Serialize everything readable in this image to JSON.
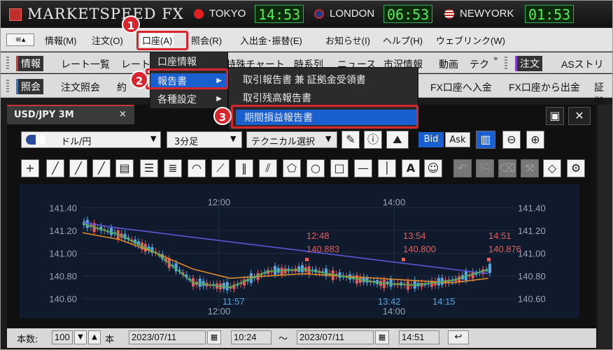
{
  "app": {
    "title": "MARKETSPEED FX"
  },
  "markets": [
    {
      "name": "TOKYO",
      "time": "14:53",
      "dot_color": "#e02020"
    },
    {
      "name": "LONDON",
      "time": "06:53",
      "dot_color": "#c62828"
    },
    {
      "name": "NEWYORK",
      "time": "01:53",
      "dot_color": "#c62828"
    }
  ],
  "menubar": {
    "items": [
      "情報(M)",
      "注文(O)",
      "口座(A)",
      "照会(R)",
      "入出金･振替(E)",
      "お知らせ(I)",
      "ヘルプ(H)",
      "ウェブリンク(W)"
    ]
  },
  "toolbar1": {
    "head": "情報",
    "items": [
      "レート一覧",
      "レート",
      "特殊チャート",
      "時系列",
      "ニュース",
      "市況情報",
      "動画",
      "テク"
    ],
    "head2": "注文",
    "item2": "ASストリー"
  },
  "toolbar2": {
    "head": "照会",
    "items": [
      "注文照会",
      "約"
    ],
    "items_right": [
      "FX口座へ入金",
      "FX口座から出金",
      "証拠"
    ]
  },
  "menu_account": {
    "items": [
      "口座情報",
      "報告書",
      "各種設定"
    ]
  },
  "menu_reports": {
    "items": [
      "取引報告書 兼 証拠金受領書",
      "取引残高報告書",
      "期間損益報告書"
    ]
  },
  "callouts": [
    "1",
    "2",
    "3"
  ],
  "chart_window": {
    "tab": "USD/JPY 3M",
    "close": "×",
    "pair": "ドル/円",
    "interval": "3分足",
    "technical": "テクニカル選択",
    "bid": "Bid",
    "ask": "Ask"
  },
  "chart_data": {
    "type": "line",
    "y_ticks": [
      "141.40",
      "141.20",
      "141.00",
      "140.80",
      "140.60"
    ],
    "ylim": [
      140.5,
      141.42
    ],
    "x_top": [
      "12:00",
      "14:00"
    ],
    "x_bottom": [
      "12:00",
      "14:00"
    ],
    "x_bottom_cut": [
      "11:57",
      "13:42",
      "14:15"
    ],
    "annotations": [
      {
        "time": "12:48",
        "value": "140.883"
      },
      {
        "time": "13:54",
        "value": "140.800"
      },
      {
        "time": "14:51",
        "value": "140.876"
      }
    ],
    "series": [
      {
        "color": "#5a56d6",
        "values": [
          141.27,
          141.22,
          141.18,
          141.14,
          141.1,
          141.06,
          141.02,
          140.98,
          140.94,
          140.9,
          140.86,
          140.82
        ]
      },
      {
        "color": "#e08a2a",
        "values": [
          141.18,
          141.12,
          141.0,
          140.86,
          140.78,
          140.8,
          140.82,
          140.8,
          140.78,
          140.76,
          140.74,
          140.78
        ]
      },
      {
        "color": "#4caf50",
        "values": [
          141.26,
          141.16,
          141.0,
          140.74,
          140.7,
          140.84,
          140.86,
          140.8,
          140.74,
          140.72,
          140.76,
          140.86
        ]
      }
    ],
    "candle_color_up": "#e06060",
    "candle_color_down": "#5aa8e0"
  },
  "bottombar": {
    "count_label": "本数:",
    "count": "100",
    "unit": "本",
    "date_from": "2023/07/11",
    "time_from": "10:24",
    "tilde": "～",
    "date_to": "2023/07/11",
    "time_to": "14:51"
  }
}
